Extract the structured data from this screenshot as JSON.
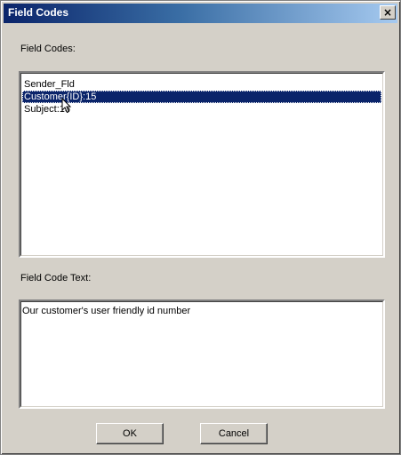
{
  "window": {
    "title": "Field Codes",
    "close_icon": "close-icon"
  },
  "field_codes": {
    "label": "Field Codes:",
    "items": [
      {
        "label": "Sender_Fld",
        "selected": false
      },
      {
        "label": "Customer{ID}:15",
        "selected": true
      },
      {
        "label": "Subject:15",
        "selected": false
      }
    ]
  },
  "field_code_text": {
    "label": "Field Code Text:",
    "value": "Our customer's user friendly id number"
  },
  "buttons": {
    "ok": "OK",
    "cancel": "Cancel"
  }
}
